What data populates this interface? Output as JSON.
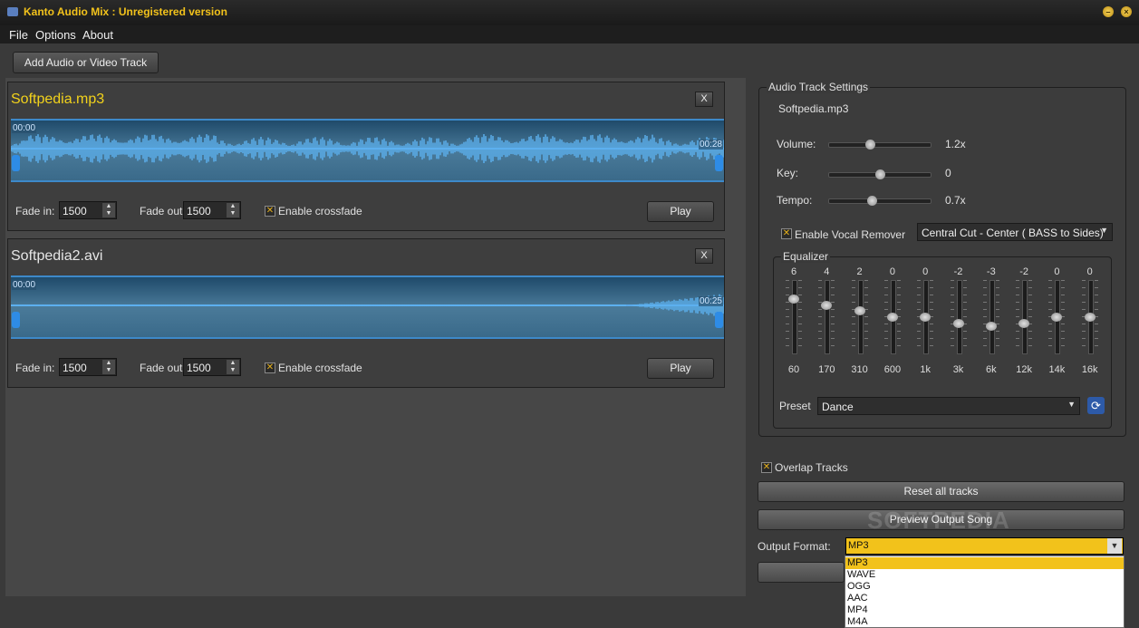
{
  "window": {
    "title": "Kanto Audio Mix : Unregistered version"
  },
  "menu": {
    "items": [
      "File",
      "Options",
      "About"
    ]
  },
  "toolbar": {
    "add_label": "Add Audio or Video Track"
  },
  "tracks": [
    {
      "name": "Softpedia.mp3",
      "name_color": "#f2d21b",
      "start_time": "00:00",
      "end_time": "00:28",
      "fade_in_label": "Fade in:",
      "fade_in": "1500",
      "fade_out_label": "Fade out:",
      "fade_out": "1500",
      "crossfade_label": "Enable crossfade",
      "crossfade_checked": true,
      "play_label": "Play",
      "close_label": "X"
    },
    {
      "name": "Softpedia2.avi",
      "name_color": "#e6e6e6",
      "start_time": "00:00",
      "end_time": "00:25",
      "fade_in_label": "Fade in:",
      "fade_in": "1500",
      "fade_out_label": "Fade out:",
      "fade_out": "1500",
      "crossfade_label": "Enable crossfade",
      "crossfade_checked": true,
      "play_label": "Play",
      "close_label": "X"
    }
  ],
  "settings": {
    "title": "Audio Track Settings",
    "track_name": "Softpedia.mp3",
    "volume": {
      "label": "Volume:",
      "value": "1.2x",
      "level": 0.4
    },
    "key": {
      "label": "Key:",
      "value": "0",
      "level": 0.5
    },
    "tempo": {
      "label": "Tempo:",
      "value": "0.7x",
      "level": 0.42
    },
    "vocal_remover_label": "Enable Vocal Remover",
    "vocal_remover_checked": true,
    "vocal_mode": "Central Cut - Center ( BASS to Sides)",
    "equalizer": {
      "title": "Equalizer",
      "bands": [
        {
          "freq": "60",
          "gain": "6"
        },
        {
          "freq": "170",
          "gain": "4"
        },
        {
          "freq": "310",
          "gain": "2"
        },
        {
          "freq": "600",
          "gain": "0"
        },
        {
          "freq": "1k",
          "gain": "0"
        },
        {
          "freq": "3k",
          "gain": "-2"
        },
        {
          "freq": "6k",
          "gain": "-3"
        },
        {
          "freq": "12k",
          "gain": "-2"
        },
        {
          "freq": "14k",
          "gain": "0"
        },
        {
          "freq": "16k",
          "gain": "0"
        }
      ],
      "preset_label": "Preset",
      "preset_value": "Dance"
    }
  },
  "overlap": {
    "label": "Overlap Tracks",
    "checked": true
  },
  "buttons": {
    "reset": "Reset all tracks",
    "preview": "Preview Output Song"
  },
  "output": {
    "label": "Output Format:",
    "selected": "MP3",
    "options": [
      "MP3",
      "WAVE",
      "OGG",
      "AAC",
      "MP4",
      "M4A"
    ]
  },
  "watermark": "SOFTPEDIA"
}
